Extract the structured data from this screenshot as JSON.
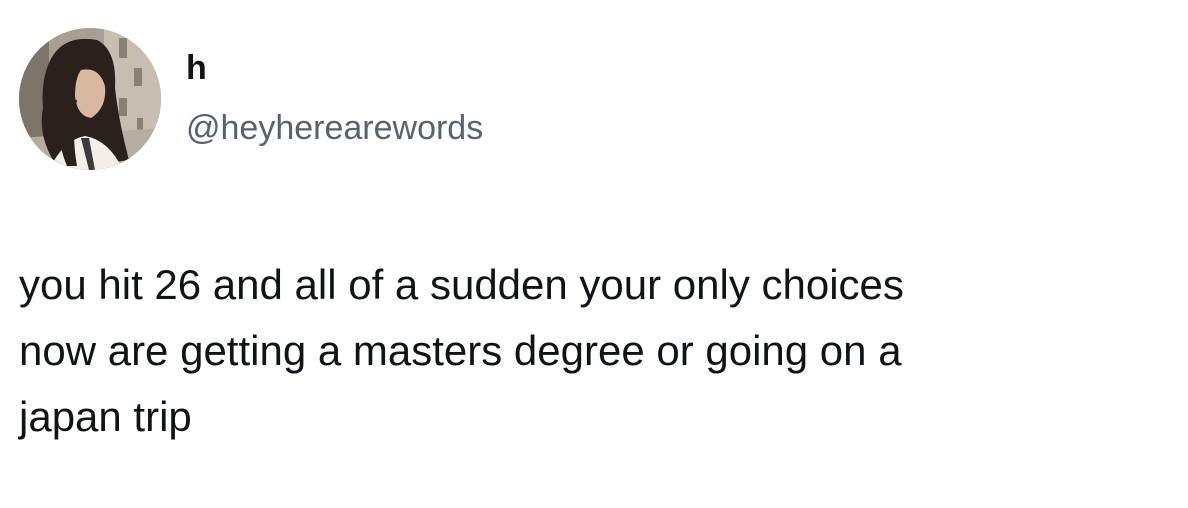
{
  "author": {
    "display_name": "h",
    "handle": "@heyherearewords",
    "avatar_icon": "profile-photo-icon"
  },
  "tweet": {
    "lines": [
      "you hit 26 and all of a sudden your only choices",
      "now are getting a masters degree or going on a",
      "japan trip"
    ]
  },
  "colors": {
    "text_primary": "#0f1419",
    "text_secondary": "#536471",
    "background": "#ffffff"
  }
}
